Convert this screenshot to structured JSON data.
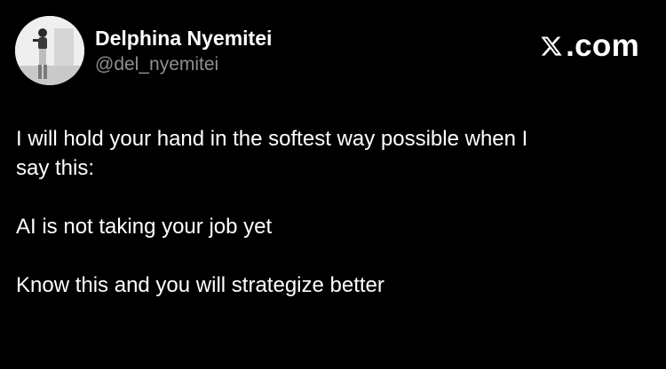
{
  "author": {
    "display_name": "Delphina Nyemitei",
    "handle": "@del_nyemitei",
    "avatar_icon": "profile-photo"
  },
  "brand": {
    "logo_icon": "x-logo-icon",
    "text": ".com"
  },
  "tweet": {
    "lines": [
      "I will hold your hand in the softest way possible when I",
      "say this:",
      "AI is not taking your job yet",
      "Know this and you will strategize better"
    ]
  },
  "colors": {
    "background": "#000000",
    "text": "#ffffff",
    "handle": "#8b8f94"
  }
}
